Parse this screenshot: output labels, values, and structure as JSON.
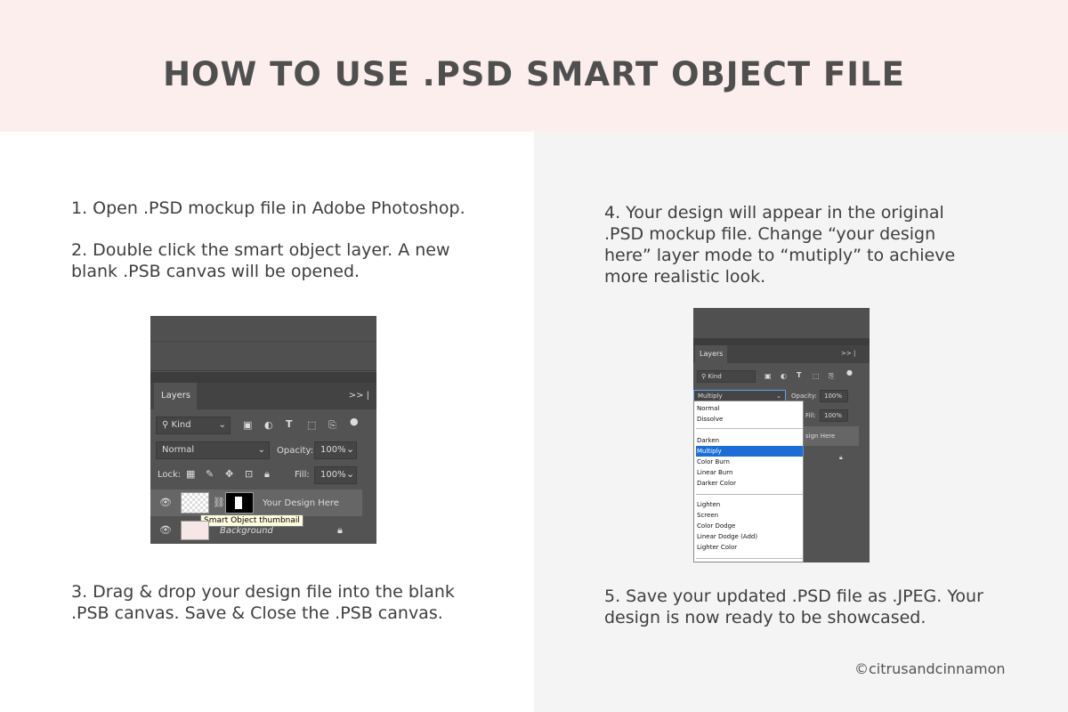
{
  "header": {
    "title": "HOW TO USE .PSD SMART OBJECT FILE"
  },
  "steps": {
    "s1": "1. Open .PSD mockup file in Adobe Photoshop.",
    "s2_l1": "2. Double click the smart object layer. A new",
    "s2_l2": "blank  .PSB canvas will be opened.",
    "s3_l1": "3. Drag & drop your design file into the blank",
    "s3_l2": ".PSB canvas. Save & Close the .PSB canvas.",
    "s4_l1": "4. Your design will appear in the original",
    "s4_l2": ".PSD mockup file. Change “your design",
    "s4_l3": "here” layer mode to “mutiply” to achieve",
    "s4_l4": "more realistic look.",
    "s5_l1": "5. Save your updated .PSD file as .JPEG. Your",
    "s5_l2": "design is now ready to be showcased."
  },
  "credit": "©citrusandcinnamon",
  "panel1": {
    "tab": "Layers",
    "filter": "Kind",
    "blend_mode": "Normal",
    "opacity_label": "Opacity:",
    "opacity_value": "100%",
    "lock_label": "Lock:",
    "fill_label": "Fill:",
    "fill_value": "100%",
    "layer1_name": "Your Design Here",
    "layer2_name": "Background",
    "tooltip": "Smart Object thumbnail",
    "menu_glyph": ">> |"
  },
  "panel2": {
    "tab": "Layers",
    "filter": "Kind",
    "blend_mode": "Multiply",
    "opacity_label": "Opacity:",
    "opacity_value": "100%",
    "fill_label": "Fill:",
    "fill_value": "100%",
    "layer_partial": "sign Here",
    "menu_glyph": ">> |",
    "options": [
      "Normal",
      "Dissolve",
      "Darken",
      "Multiply",
      "Color Burn",
      "Linear Burn",
      "Darker Color",
      "Lighten",
      "Screen",
      "Color Dodge",
      "Linear Dodge (Add)",
      "Lighter Color"
    ],
    "selected": "Multiply"
  }
}
